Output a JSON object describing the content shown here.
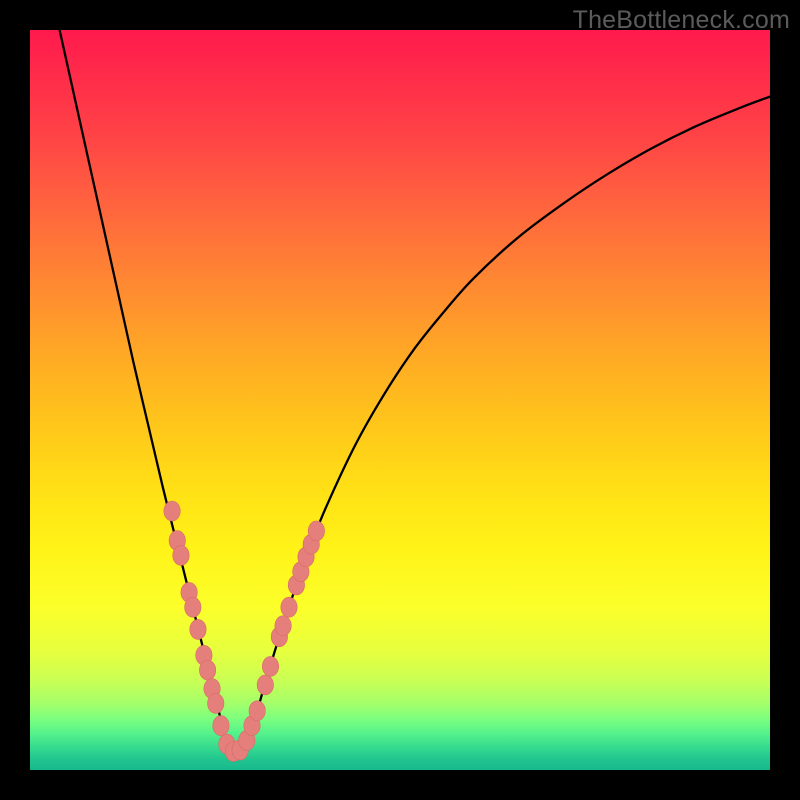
{
  "watermark": "TheBottleneck.com",
  "colors": {
    "background": "#000000",
    "curve": "#000000",
    "marker_fill": "#e57f7b",
    "marker_stroke": "#d86b67"
  },
  "chart_data": {
    "type": "line",
    "title": "",
    "xlabel": "",
    "ylabel": "",
    "x_range": [
      0,
      100
    ],
    "y_range": [
      0,
      100
    ],
    "notes": "V-shaped bottleneck curve; y≈100 is far from optimal, y≈0 is optimal (minimum). Vertex near x≈27.",
    "series": [
      {
        "name": "bottleneck-curve",
        "x": [
          4,
          6,
          8,
          10,
          12,
          14,
          16,
          18,
          20,
          22,
          24,
          25,
          26,
          27,
          28,
          29,
          30,
          31,
          32,
          34,
          36,
          38,
          40,
          44,
          48,
          52,
          56,
          60,
          66,
          72,
          78,
          84,
          90,
          96,
          100
        ],
        "y": [
          100,
          91,
          82,
          73,
          64,
          55,
          46.5,
          38,
          30,
          22,
          14,
          10,
          6,
          2.5,
          1.5,
          2.5,
          5.5,
          9,
          12.5,
          19,
          25,
          30.5,
          35.5,
          44,
          51,
          57,
          62,
          66.5,
          72,
          76.5,
          80.5,
          84,
          87,
          89.5,
          91
        ]
      }
    ],
    "markers": {
      "name": "highlighted-points",
      "points": [
        {
          "x": 19.2,
          "y": 35.0
        },
        {
          "x": 19.9,
          "y": 31.0
        },
        {
          "x": 20.4,
          "y": 29.0
        },
        {
          "x": 21.5,
          "y": 24.0
        },
        {
          "x": 22.0,
          "y": 22.0
        },
        {
          "x": 22.7,
          "y": 19.0
        },
        {
          "x": 23.5,
          "y": 15.5
        },
        {
          "x": 24.0,
          "y": 13.5
        },
        {
          "x": 24.6,
          "y": 11.0
        },
        {
          "x": 25.1,
          "y": 9.0
        },
        {
          "x": 25.8,
          "y": 6.0
        },
        {
          "x": 26.6,
          "y": 3.5
        },
        {
          "x": 27.5,
          "y": 2.5
        },
        {
          "x": 28.4,
          "y": 2.7
        },
        {
          "x": 29.3,
          "y": 4.0
        },
        {
          "x": 30.0,
          "y": 6.0
        },
        {
          "x": 30.7,
          "y": 8.0
        },
        {
          "x": 31.8,
          "y": 11.5
        },
        {
          "x": 32.5,
          "y": 14.0
        },
        {
          "x": 33.7,
          "y": 18.0
        },
        {
          "x": 34.2,
          "y": 19.5
        },
        {
          "x": 35.0,
          "y": 22.0
        },
        {
          "x": 36.0,
          "y": 25.0
        },
        {
          "x": 36.6,
          "y": 26.8
        },
        {
          "x": 37.3,
          "y": 28.8
        },
        {
          "x": 38.0,
          "y": 30.5
        },
        {
          "x": 38.7,
          "y": 32.3
        }
      ]
    }
  }
}
